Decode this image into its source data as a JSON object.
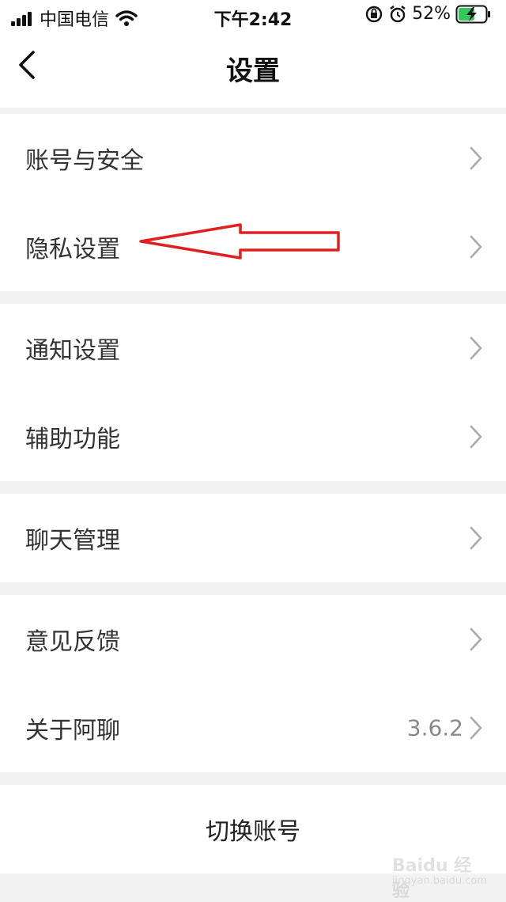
{
  "status_bar": {
    "carrier": "中国电信",
    "time": "下午2:42",
    "battery": "52%"
  },
  "nav": {
    "title": "设置",
    "back_icon": "chevron-left-icon"
  },
  "sections": [
    {
      "items": [
        {
          "label": "账号与安全"
        },
        {
          "label": "隐私设置"
        }
      ]
    },
    {
      "items": [
        {
          "label": "通知设置"
        },
        {
          "label": "辅助功能"
        }
      ]
    },
    {
      "items": [
        {
          "label": "聊天管理"
        }
      ]
    },
    {
      "items": [
        {
          "label": "意见反馈"
        },
        {
          "label": "关于阿聊",
          "value": "3.6.2"
        }
      ]
    }
  ],
  "switch_account": {
    "label": "切换账号"
  },
  "annotation": {
    "color": "#e02020",
    "icon": "arrow-left-icon"
  },
  "watermark": {
    "text": "Baidu 经验",
    "subtext": "jingyan.baidu.com"
  }
}
